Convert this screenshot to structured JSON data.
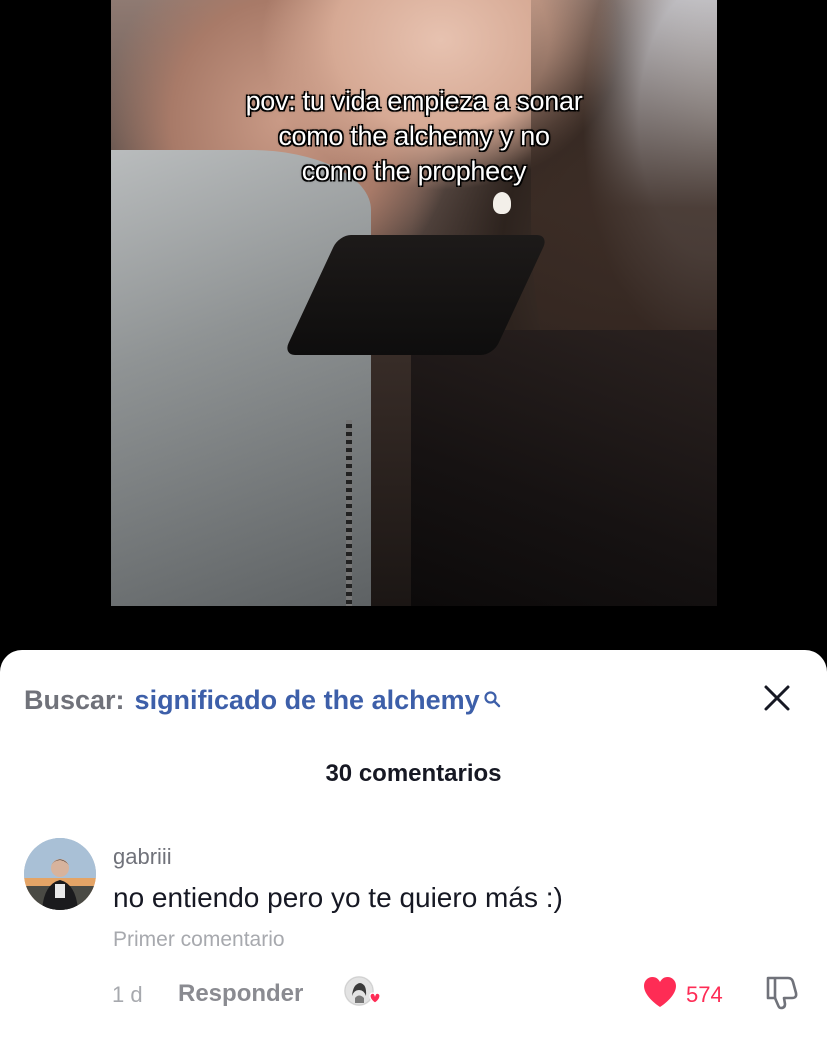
{
  "video": {
    "overlay_lines": [
      "pov: tu vida empieza a sonar",
      "como the alchemy y no",
      "como the prophecy"
    ]
  },
  "search": {
    "prefix": "Buscar:",
    "query": "significado de the alchemy",
    "icon": "search-icon"
  },
  "close_icon": "close-icon",
  "comments": {
    "count_label": "30 comentarios",
    "items": [
      {
        "username": "gabriii",
        "text": "no entiendo pero yo te quiero más :)",
        "sub_label": "Primer comentario",
        "age": "1 d",
        "reply_label": "Responder",
        "likes": "574",
        "liked_by_creator": true
      }
    ]
  },
  "colors": {
    "accent_like": "#fe2c55",
    "search_link": "#3d5fa9",
    "text_primary": "#161823",
    "text_secondary": "#70727a"
  }
}
